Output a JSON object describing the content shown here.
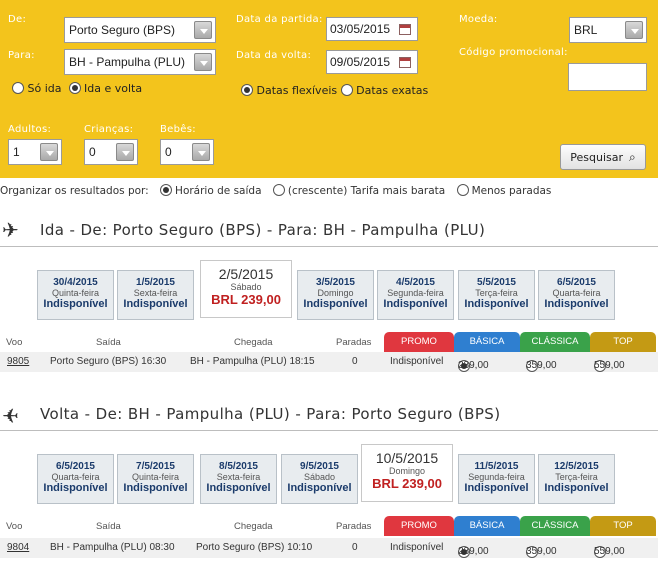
{
  "search": {
    "from_label": "De:",
    "from_value": "Porto Seguro (BPS)",
    "to_label": "Para:",
    "to_value": "BH - Pampulha (PLU)",
    "depart_label": "Data da partida:",
    "depart_value": "03/05/2015",
    "return_label": "Data da volta:",
    "return_value": "09/05/2015",
    "currency_label": "Moeda:",
    "currency_value": "BRL",
    "promo_label": "Código promocional:",
    "promo_value": "",
    "trip_oneway": "Só ida",
    "trip_round": "Ida e volta",
    "dates_flex": "Datas flexíveis",
    "dates_exact": "Datas exatas",
    "adults_label": "Adultos:",
    "adults_value": "1",
    "children_label": "Crianças:",
    "children_value": "0",
    "infants_label": "Bebês:",
    "infants_value": "0",
    "search_button": "Pesquisar"
  },
  "sort": {
    "label": "Organizar os resultados por:",
    "opt1": "Horário de saída",
    "opt2": "(crescente) Tarifa mais barata",
    "opt3": "Menos paradas"
  },
  "columns": {
    "voo": "Voo",
    "saida": "Saída",
    "chegada": "Chegada",
    "paradas": "Paradas",
    "promo": "PROMO",
    "basica": "BÁSICA",
    "classica": "CLÁSSICA",
    "top": "TOP"
  },
  "outbound": {
    "title": "Ida - De: Porto Seguro (BPS) - Para: BH - Pampulha (PLU)",
    "dates": [
      {
        "date": "30/4/2015",
        "weekday": "Quinta-feira",
        "status": "Indisponível"
      },
      {
        "date": "1/5/2015",
        "weekday": "Sexta-feira",
        "status": "Indisponível"
      },
      {
        "date": "2/5/2015",
        "weekday": "Sábado",
        "status": "BRL 239,00"
      },
      {
        "date": "3/5/2015",
        "weekday": "Domingo",
        "status": "Indisponível"
      },
      {
        "date": "4/5/2015",
        "weekday": "Segunda-feira",
        "status": "Indisponível"
      },
      {
        "date": "5/5/2015",
        "weekday": "Terça-feira",
        "status": "Indisponível"
      },
      {
        "date": "6/5/2015",
        "weekday": "Quarta-feira",
        "status": "Indisponível"
      }
    ],
    "flight": {
      "number": "9805",
      "departure": "Porto Seguro (BPS) 16:30",
      "arrival": "BH - Pampulha (PLU) 18:15",
      "stops": "0",
      "promo": "Indisponível",
      "basica": "239,00",
      "classica": "359,00",
      "top": "559,00"
    }
  },
  "inbound": {
    "title": "Volta - De: BH - Pampulha (PLU) - Para: Porto Seguro (BPS)",
    "dates": [
      {
        "date": "6/5/2015",
        "weekday": "Quarta-feira",
        "status": "Indisponível"
      },
      {
        "date": "7/5/2015",
        "weekday": "Quinta-feira",
        "status": "Indisponível"
      },
      {
        "date": "8/5/2015",
        "weekday": "Sexta-feira",
        "status": "Indisponível"
      },
      {
        "date": "9/5/2015",
        "weekday": "Sábado",
        "status": "Indisponível"
      },
      {
        "date": "10/5/2015",
        "weekday": "Domingo",
        "status": "BRL 239,00"
      },
      {
        "date": "11/5/2015",
        "weekday": "Segunda-feira",
        "status": "Indisponível"
      },
      {
        "date": "12/5/2015",
        "weekday": "Terça-feira",
        "status": "Indisponível"
      }
    ],
    "flight": {
      "number": "9804",
      "departure": "BH - Pampulha (PLU) 08:30",
      "arrival": "Porto Seguro (BPS) 10:10",
      "stops": "0",
      "promo": "Indisponível",
      "basica": "239,00",
      "classica": "359,00",
      "top": "559,00"
    }
  },
  "colors": {
    "panel": "#f3c41c",
    "promo": "#e0373f",
    "basica": "#2f7fd0",
    "classica": "#3aa24a",
    "top": "#c49a14"
  }
}
